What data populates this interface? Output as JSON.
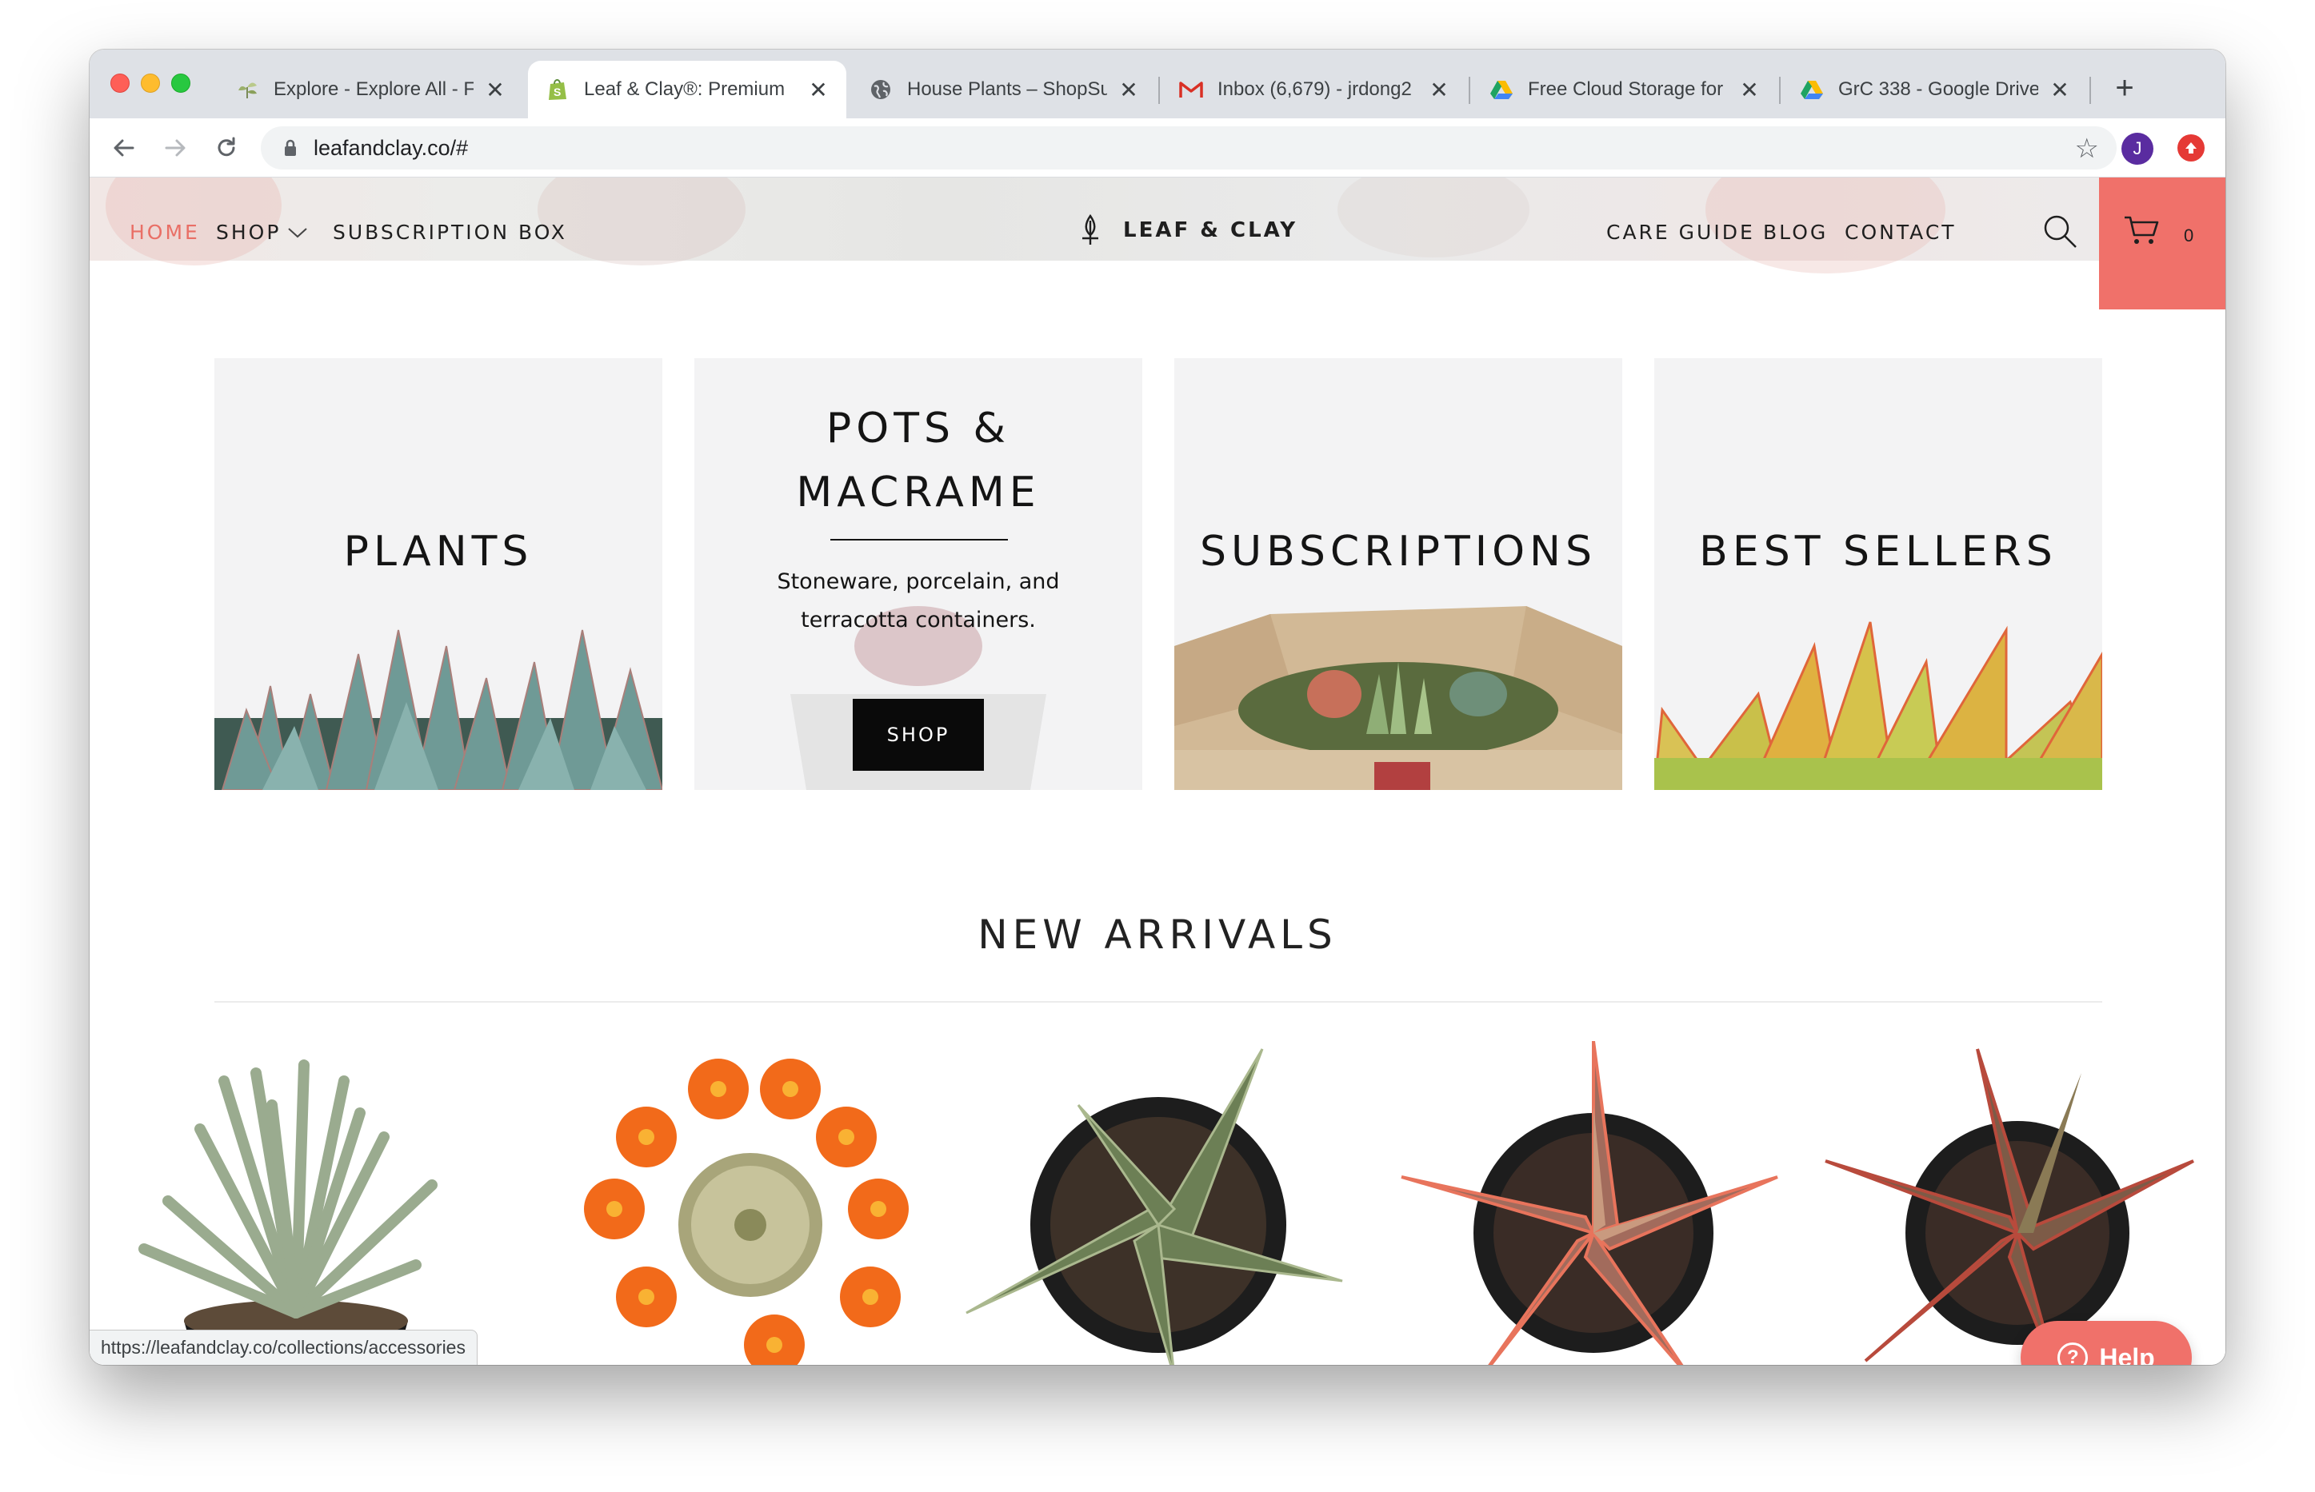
{
  "browser": {
    "tabs": [
      {
        "title": "Explore - Explore All - F",
        "favicon": "explore-plant-icon"
      },
      {
        "title": "Leaf & Clay®: Premium",
        "favicon": "shopify-icon"
      },
      {
        "title": "House Plants – ShopSu",
        "favicon": "globe-icon"
      },
      {
        "title": "Inbox (6,679) - jrdong2",
        "favicon": "gmail-icon"
      },
      {
        "title": "Free Cloud Storage for",
        "favicon": "google-drive-icon"
      },
      {
        "title": "GrC 338 - Google Drive",
        "favicon": "google-drive-icon"
      }
    ],
    "active_tab": 1,
    "close_glyph": "✕",
    "new_tab_glyph": "+",
    "url": "leafandclay.co/#",
    "profile_initial": "J",
    "status_url": "https://leafandclay.co/collections/accessories"
  },
  "site": {
    "nav_left": [
      "HOME",
      "SHOP",
      "SUBSCRIPTION BOX"
    ],
    "brand": "LEAF & CLAY",
    "nav_right": [
      "CARE GUIDE",
      "BLOG",
      "CONTACT"
    ],
    "cart_count": "0",
    "accent_color": "#f0716a"
  },
  "categories": [
    {
      "title": "PLANTS"
    },
    {
      "title_line1": "POTS &",
      "title_line2": "MACRAME",
      "description_line1": "Stoneware, porcelain, and",
      "description_line2": "terracotta containers.",
      "button": "SHOP"
    },
    {
      "title": "SUBSCRIPTIONS"
    },
    {
      "title": "BEST SELLERS"
    }
  ],
  "new_arrivals": {
    "heading": "NEW ARRIVALS",
    "products": [
      "haworthia-plant",
      "orange-flowering-cactus",
      "aloe-star-plant",
      "pink-aloe-star-plant",
      "red-aloe-plant"
    ]
  },
  "help": {
    "label": "Help"
  }
}
